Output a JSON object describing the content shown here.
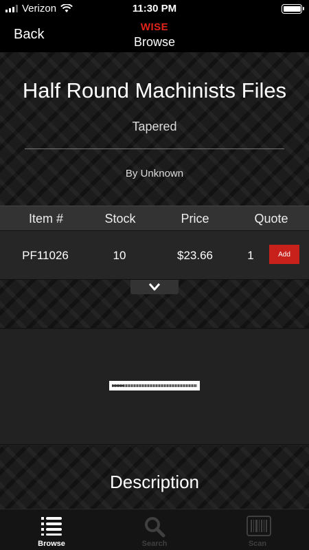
{
  "status": {
    "carrier": "Verizon",
    "time": "11:30 PM",
    "battery_level": 0.9
  },
  "nav": {
    "back_label": "Back",
    "brand": "WISE",
    "title": "Browse"
  },
  "product": {
    "title": "Half Round Machinists Files",
    "subtitle": "Tapered",
    "byline": "By Unknown"
  },
  "table": {
    "headers": [
      "Item #",
      "Stock",
      "Price",
      "Quote"
    ],
    "row": {
      "item": "PF11026",
      "stock": "10",
      "price": "$23.66",
      "quote": "1",
      "add_label": "Add"
    }
  },
  "description": {
    "title": "Description"
  },
  "tabs": [
    {
      "label": "Browse",
      "icon": "list-icon",
      "active": true
    },
    {
      "label": "Search",
      "icon": "search-icon",
      "active": false
    },
    {
      "label": "Scan",
      "icon": "barcode-icon",
      "active": false
    }
  ],
  "colors": {
    "accent": "#e0241b",
    "add_button": "#c8201b"
  }
}
